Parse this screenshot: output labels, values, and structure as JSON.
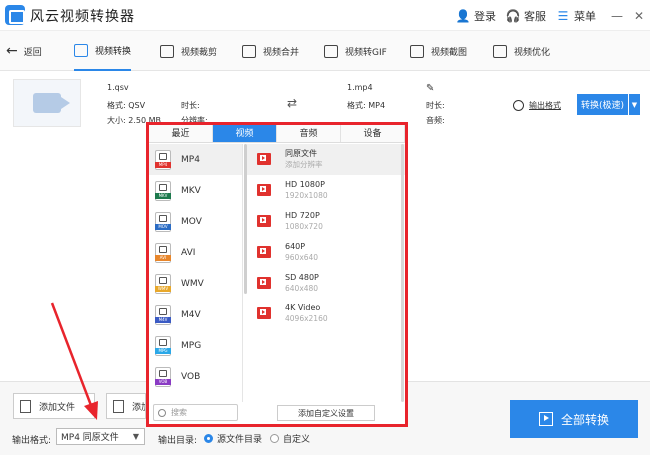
{
  "titlebar": {
    "app_title": "风云视频转换器",
    "login": "登录",
    "service": "客服",
    "menu": "菜单",
    "minimize": "—",
    "close": "✕"
  },
  "toolbar": {
    "back": "返回",
    "tools": [
      "视频转换",
      "视频裁剪",
      "视频合并",
      "视频转GIF",
      "视频截图",
      "视频优化"
    ]
  },
  "source_file": {
    "name": "1.qsv",
    "format_label": "格式:",
    "format": "QSV",
    "size_label": "大小:",
    "size": "2.50 MB",
    "duration_label": "时长:",
    "resolution_label": "分辨率:"
  },
  "target_file": {
    "name": "1.mp4",
    "format_label": "格式:",
    "format": "MP4",
    "duration_label": "时长:",
    "resolution_label": "分辨率:",
    "audio_label": "音频:"
  },
  "output_settings": "输出格式",
  "convert_button": "转换(极速)",
  "popup": {
    "tabs": [
      "最近",
      "视频",
      "音频",
      "设备"
    ],
    "active_tab": 1,
    "formats": [
      {
        "name": "MP4",
        "color": "#e0322e"
      },
      {
        "name": "MKV",
        "color": "#1d7a4d"
      },
      {
        "name": "MOV",
        "color": "#2b6cc4"
      },
      {
        "name": "AVI",
        "color": "#e8862b"
      },
      {
        "name": "WMV",
        "color": "#e8a82b"
      },
      {
        "name": "M4V",
        "color": "#3b5bc4"
      },
      {
        "name": "MPG",
        "color": "#2ba8e8"
      },
      {
        "name": "VOB",
        "color": "#8a3bc4"
      }
    ],
    "resolutions": [
      {
        "name": "同原文件",
        "size": "添加分辨率"
      },
      {
        "name": "HD 1080P",
        "size": "1920x1080"
      },
      {
        "name": "HD 720P",
        "size": "1080x720"
      },
      {
        "name": "640P",
        "size": "960x640"
      },
      {
        "name": "SD 480P",
        "size": "640x480"
      },
      {
        "name": "4K Video",
        "size": "4096x2160"
      }
    ],
    "search_placeholder": "搜索",
    "custom_button": "添加自定义设置"
  },
  "bottom": {
    "add_file": "添加文件",
    "add_folder": "添加",
    "format_label": "输出格式:",
    "format_value": "MP4 同原文件",
    "dir_label": "输出目录:",
    "radio_source": "源文件目录",
    "radio_custom": "自定义",
    "convert_all": "全部转换"
  },
  "colors": {
    "accent": "#2b87e8",
    "annotation": "#e8242c"
  }
}
